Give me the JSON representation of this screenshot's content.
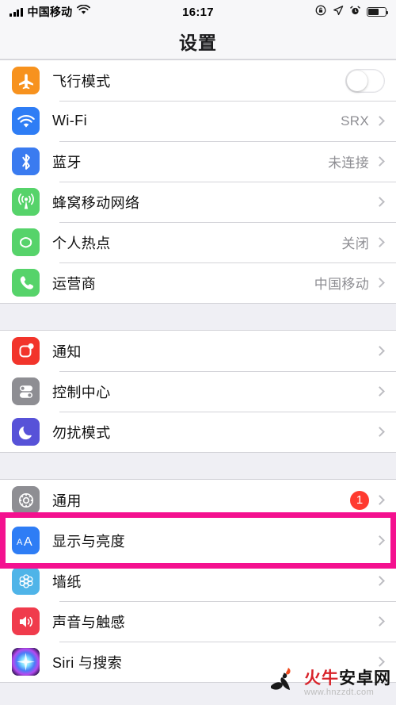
{
  "status_bar": {
    "carrier": "中国移动",
    "time": "16:17",
    "signal_icon": "signal-bars-icon",
    "wifi_icon": "wifi-icon",
    "rotation_lock_icon": "rotation-lock-icon",
    "location_icon": "location-arrow-icon",
    "alarm_icon": "alarm-clock-icon",
    "battery_icon": "battery-icon",
    "battery_level": 62
  },
  "nav": {
    "title": "设置"
  },
  "groups": [
    {
      "id": "connectivity",
      "rows": [
        {
          "id": "airplane-mode",
          "label": "飞行模式",
          "icon": "airplane-icon",
          "icon_color": "#F7921E",
          "control": "toggle",
          "toggle_on": false
        },
        {
          "id": "wifi",
          "label": "Wi-Fi",
          "icon": "wifi-icon",
          "icon_color": "#2E7DF5",
          "control": "chevron",
          "detail": "SRX"
        },
        {
          "id": "bluetooth",
          "label": "蓝牙",
          "icon": "bluetooth-icon",
          "icon_color": "#3A7BF0",
          "control": "chevron",
          "detail": "未连接"
        },
        {
          "id": "cellular",
          "label": "蜂窝移动网络",
          "icon": "cellular-tower-icon",
          "icon_color": "#56D36A",
          "control": "chevron",
          "detail": ""
        },
        {
          "id": "hotspot",
          "label": "个人热点",
          "icon": "hotspot-link-icon",
          "icon_color": "#56D36A",
          "control": "chevron",
          "detail": "关闭"
        },
        {
          "id": "carrier",
          "label": "运营商",
          "icon": "phone-icon",
          "icon_color": "#56D36A",
          "control": "chevron",
          "detail": "中国移动"
        }
      ]
    },
    {
      "id": "alerts",
      "rows": [
        {
          "id": "notifications",
          "label": "通知",
          "icon": "notification-badge-icon",
          "icon_color": "#F2342B",
          "control": "chevron",
          "detail": ""
        },
        {
          "id": "control-center",
          "label": "控制中心",
          "icon": "control-center-icon",
          "icon_color": "#8E8E93",
          "control": "chevron",
          "detail": ""
        },
        {
          "id": "do-not-disturb",
          "label": "勿扰模式",
          "icon": "moon-icon",
          "icon_color": "#5752D8",
          "control": "chevron",
          "detail": ""
        }
      ]
    },
    {
      "id": "system",
      "rows": [
        {
          "id": "general",
          "label": "通用",
          "icon": "gear-icon",
          "icon_color": "#8E8E93",
          "control": "chevron",
          "badge": "1"
        },
        {
          "id": "display-brightness",
          "label": "显示与亮度",
          "icon": "text-size-aa-icon",
          "icon_color": "#2E7DF5",
          "control": "chevron",
          "detail": "",
          "highlighted": true
        },
        {
          "id": "wallpaper",
          "label": "墙纸",
          "icon": "wallpaper-flower-icon",
          "icon_color": "#4FB4E8",
          "control": "chevron",
          "detail": ""
        },
        {
          "id": "sounds-haptics",
          "label": "声音与触感",
          "icon": "speaker-icon",
          "icon_color": "#F03B4C",
          "control": "chevron",
          "detail": ""
        },
        {
          "id": "siri-search",
          "label": "Siri 与搜索",
          "icon": "siri-icon",
          "icon_color": "#1b1b2a",
          "control": "chevron",
          "detail": ""
        }
      ]
    }
  ],
  "highlight": {
    "target": "显示与亮度",
    "color": "#F4118F"
  },
  "watermark": {
    "brand_red": "火牛",
    "brand_black": "安卓网",
    "url": "www.hnzzdt.com",
    "logo_icon": "torch-flame-icon"
  }
}
